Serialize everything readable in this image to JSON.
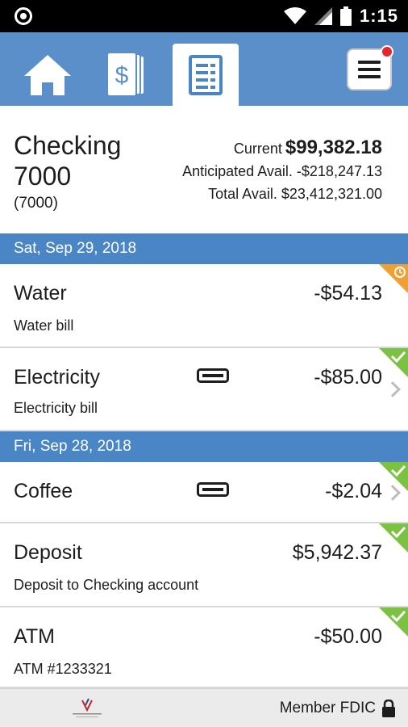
{
  "status_bar": {
    "time": "1:15"
  },
  "nav": {
    "tabs": [
      {
        "icon": "home-icon",
        "active": false
      },
      {
        "icon": "money-stack-icon",
        "active": false
      },
      {
        "icon": "register-list-icon",
        "active": true
      }
    ],
    "menu_icon": "hamburger-menu-icon",
    "notification_color": "#e8262d"
  },
  "account": {
    "name": "Checking 7000",
    "number": "(7000)",
    "current_label": "Current",
    "current_value": "$99,382.18",
    "anticipated_label": "Anticipated Avail.",
    "anticipated_value": "-$218,247.13",
    "total_label": "Total Avail.",
    "total_value": "$23,412,321.00"
  },
  "groups": [
    {
      "date": "Sat, Sep 29, 2018",
      "transactions": [
        {
          "name": "Water",
          "description": "Water bill",
          "amount": "-$54.13",
          "status": "pending"
        },
        {
          "name": "Electricity",
          "description": "Electricity bill",
          "amount": "-$85.00",
          "status": "cleared",
          "has_receipt": true
        }
      ]
    },
    {
      "date": "Fri, Sep 28, 2018",
      "transactions": [
        {
          "name": "Coffee",
          "description": "",
          "amount": "-$2.04",
          "status": "cleared",
          "has_receipt": true
        },
        {
          "name": "Deposit",
          "description": "Deposit to Checking account",
          "amount": "$5,942.37",
          "status": "cleared"
        },
        {
          "name": "ATM",
          "description": "ATM #1233321",
          "amount": "-$50.00",
          "status": "cleared"
        }
      ]
    }
  ],
  "footer": {
    "fdic_label": "Member FDIC"
  },
  "colors": {
    "nav_bg": "#5b8fc9",
    "date_header_bg": "#4a86c6",
    "cleared": "#7cc242",
    "pending": "#f0a030"
  }
}
